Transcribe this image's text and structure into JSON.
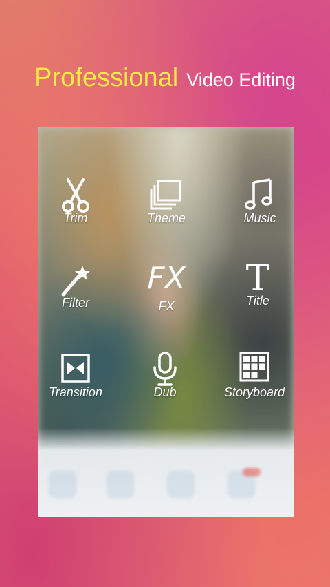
{
  "headline": {
    "highlight": "Professional",
    "rest": "Video Editing"
  },
  "tools": [
    {
      "label": "Trim",
      "icon": "scissors-icon"
    },
    {
      "label": "Theme",
      "icon": "layers-icon"
    },
    {
      "label": "Music",
      "icon": "music-note-icon"
    },
    {
      "label": "Filter",
      "icon": "magic-wand-icon"
    },
    {
      "label": "FX",
      "icon": "fx-icon",
      "glyph": "FX"
    },
    {
      "label": "Title",
      "icon": "text-title-icon",
      "glyph": "T"
    },
    {
      "label": "Transition",
      "icon": "transition-icon"
    },
    {
      "label": "Dub",
      "icon": "microphone-icon"
    },
    {
      "label": "Storyboard",
      "icon": "storyboard-grid-icon"
    }
  ],
  "colors": {
    "headline_accent": "#f7e945",
    "headline_text": "#ffffff",
    "tool_label": "#ffffff"
  }
}
